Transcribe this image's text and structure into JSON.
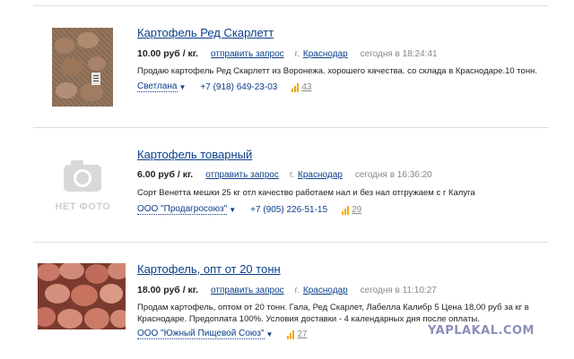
{
  "listings": [
    {
      "title": "Картофель Ред Скарлетт",
      "price": "10.00 руб / кг.",
      "request_label": "отправить запрос",
      "city_label": "г.",
      "city": "Краснодар",
      "date": "сегодня в 18:24:41",
      "description": "Продаю картофель Ред Скарлетт из Воронежа. хорошего качества. со склада в Краснодаре.10 тонн.",
      "seller": "Светлана",
      "phone": "+7 (918) 649-23-03",
      "views": "43",
      "image": "potato-sack-photo"
    },
    {
      "title": "Картофель товарный",
      "price": "6.00 руб / кг.",
      "request_label": "отправить запрос",
      "city_label": "г.",
      "city": "Краснодар",
      "date": "сегодня в 16:36:20",
      "description": "Сорт Венетта мешки 25 кг отл качество работаем нал и без нал отгружаем с г Калуга",
      "seller": "ООО \"Продагросоюз\"",
      "phone": "+7 (905) 226-51-15",
      "views": "29",
      "no_photo_label": "НЕТ ФОТО"
    },
    {
      "title": "Картофель, опт от 20 тонн",
      "price": "18.00 руб / кг.",
      "request_label": "отправить запрос",
      "city_label": "г.",
      "city": "Краснодар",
      "date": "сегодня в 11:10:27",
      "description": "Продам картофель, оптом от 20 тонн. Гала, Ред Скарлет, Лабелла Калибр 5 Цена 18,00 руб за кг в Краснодаре. Предоплата 100%. Условия доставки - 4 календарных дня после оплаты.",
      "seller": "ООО \"Южный Пищевой Союз\"",
      "phone": "",
      "views": "27",
      "image": "red-potatoes-photo"
    }
  ],
  "watermark": "YAPLAKAL.COM",
  "colors": {
    "link": "#0b3f8a",
    "muted": "#888888",
    "stats_bar": "#f0a800",
    "separator": "#dcdcdc"
  }
}
